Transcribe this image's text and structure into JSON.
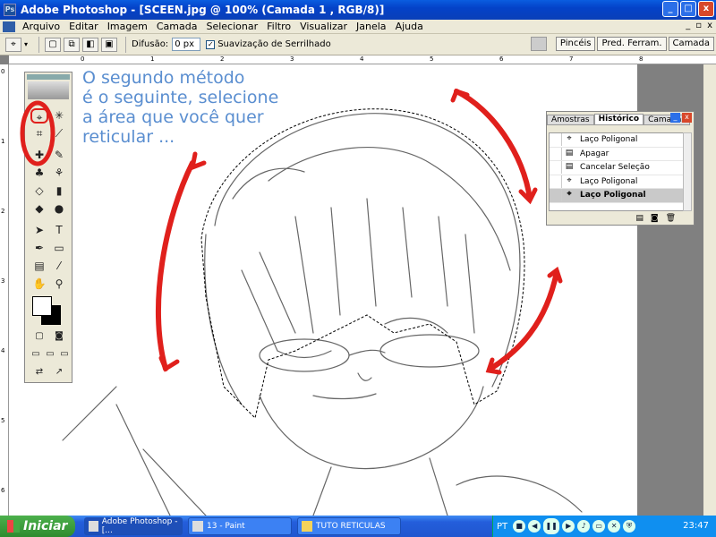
{
  "window": {
    "title": "Adobe Photoshop - [SCEEN.jpg @ 100% (Camada 1 , RGB/8)]",
    "min": "_",
    "max": "□",
    "close": "x"
  },
  "menu": [
    "Arquivo",
    "Editar",
    "Imagem",
    "Camada",
    "Selecionar",
    "Filtro",
    "Visualizar",
    "Janela",
    "Ajuda"
  ],
  "mdi": {
    "min": "_",
    "restore": "▫",
    "close": "x"
  },
  "options": {
    "feather_label": "Difusão:",
    "feather_value": "0 px",
    "antialias_label": "Suavização de Serrilhado",
    "antialias_checked": true
  },
  "palette_well": [
    "Pincéis",
    "Pred. Ferram.",
    "Camada"
  ],
  "rulers": {
    "h": [
      "0",
      "1",
      "2",
      "3",
      "4",
      "5",
      "6",
      "7",
      "8"
    ],
    "v": [
      "0",
      "1",
      "2",
      "3",
      "4",
      "5",
      "6"
    ]
  },
  "overlay": [
    "O segundo método",
    "é o seguinte, selecione",
    "a área que você quer",
    "reticular ..."
  ],
  "history": {
    "tabs": [
      "Amostras",
      "Histórico",
      "Camadas"
    ],
    "active_tab": 1,
    "items": [
      {
        "label": "Laço Poligonal",
        "icon": "lasso-icon"
      },
      {
        "label": "Apagar",
        "icon": "document-icon"
      },
      {
        "label": "Cancelar Seleção",
        "icon": "document-icon"
      },
      {
        "label": "Laço Poligonal",
        "icon": "lasso-icon"
      },
      {
        "label": "Laço Poligonal",
        "icon": "lasso-icon",
        "selected": true
      }
    ]
  },
  "taskbar": {
    "start": "Iniciar",
    "tasks": [
      {
        "label": "Adobe Photoshop - [...",
        "active": true
      },
      {
        "label": "13 - Paint",
        "active": false
      },
      {
        "label": "TUTO RETICULAS",
        "active": false
      }
    ],
    "lang": "PT",
    "clock": "23:47"
  },
  "colors": {
    "overlay_text": "#5a8ed0",
    "arrow": "#e0201c",
    "selection": "#000000"
  }
}
